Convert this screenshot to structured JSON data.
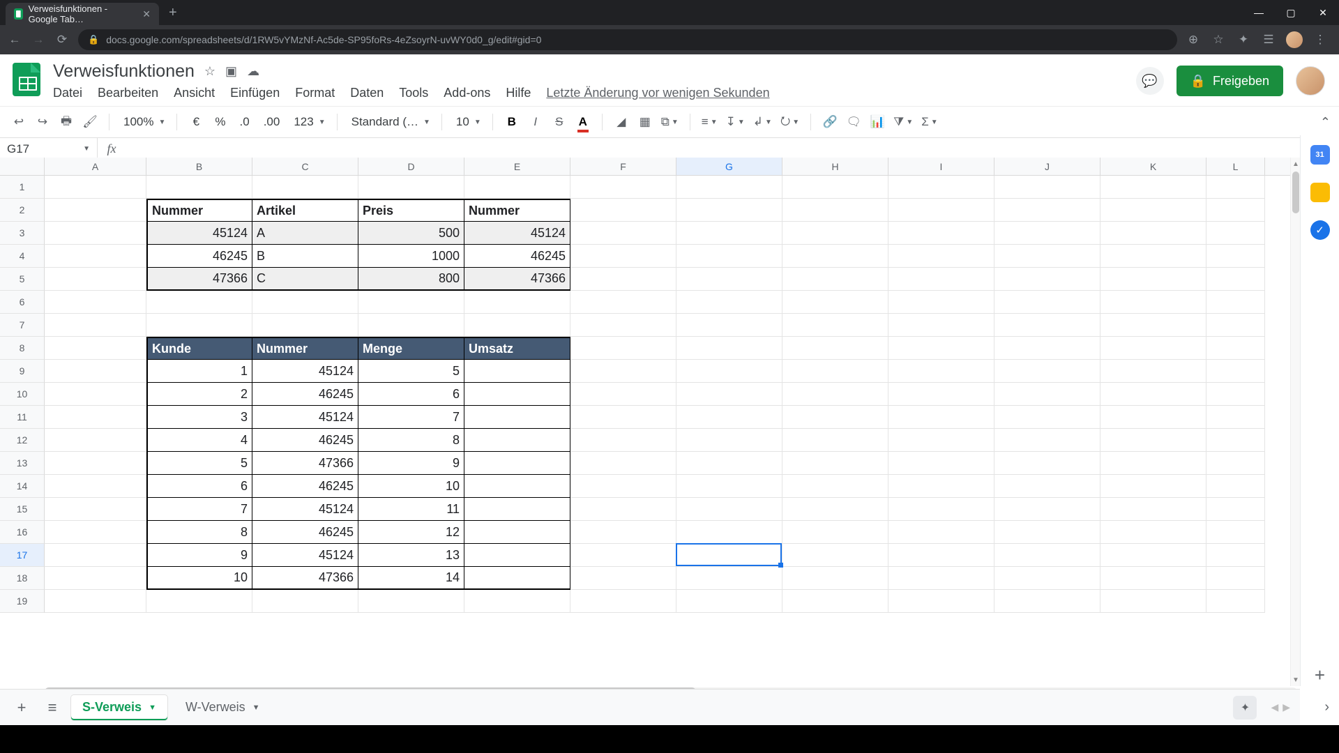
{
  "browser": {
    "tab_title": "Verweisfunktionen - Google Tab…",
    "url": "docs.google.com/spreadsheets/d/1RW5vYMzNf-Ac5de-SP95foRs-4eZsoyrN-uvWY0d0_g/edit#gid=0"
  },
  "doc": {
    "title": "Verweisfunktionen",
    "history": "Letzte Änderung vor wenigen Sekunden",
    "share": "Freigeben"
  },
  "menu": {
    "file": "Datei",
    "edit": "Bearbeiten",
    "view": "Ansicht",
    "insert": "Einfügen",
    "format": "Format",
    "data": "Daten",
    "tools": "Tools",
    "addons": "Add-ons",
    "help": "Hilfe"
  },
  "toolbar": {
    "zoom": "100%",
    "currency": "€",
    "percent": "%",
    "dec_dec": ".0",
    "inc_dec": ".00",
    "numfmt": "123",
    "font": "Standard (…",
    "size": "10"
  },
  "namebox": "G17",
  "columns": [
    "A",
    "B",
    "C",
    "D",
    "E",
    "F",
    "G",
    "H",
    "I",
    "J",
    "K",
    "L"
  ],
  "active": {
    "col": "G",
    "row": 17
  },
  "table1": {
    "headers": {
      "b": "Nummer",
      "c": "Artikel",
      "d": "Preis",
      "e": "Nummer"
    },
    "rows": [
      {
        "b": "45124",
        "c": "A",
        "d": "500",
        "e": "45124"
      },
      {
        "b": "46245",
        "c": "B",
        "d": "1000",
        "e": "46245"
      },
      {
        "b": "47366",
        "c": "C",
        "d": "800",
        "e": "47366"
      }
    ]
  },
  "table2": {
    "headers": {
      "b": "Kunde",
      "c": "Nummer",
      "d": "Menge",
      "e": "Umsatz"
    },
    "rows": [
      {
        "b": "1",
        "c": "45124",
        "d": "5"
      },
      {
        "b": "2",
        "c": "46245",
        "d": "6"
      },
      {
        "b": "3",
        "c": "45124",
        "d": "7"
      },
      {
        "b": "4",
        "c": "46245",
        "d": "8"
      },
      {
        "b": "5",
        "c": "47366",
        "d": "9"
      },
      {
        "b": "6",
        "c": "46245",
        "d": "10"
      },
      {
        "b": "7",
        "c": "45124",
        "d": "11"
      },
      {
        "b": "8",
        "c": "46245",
        "d": "12"
      },
      {
        "b": "9",
        "c": "45124",
        "d": "13"
      },
      {
        "b": "10",
        "c": "47366",
        "d": "14"
      }
    ]
  },
  "sheets": {
    "s1": "S-Verweis",
    "s2": "W-Verweis"
  }
}
